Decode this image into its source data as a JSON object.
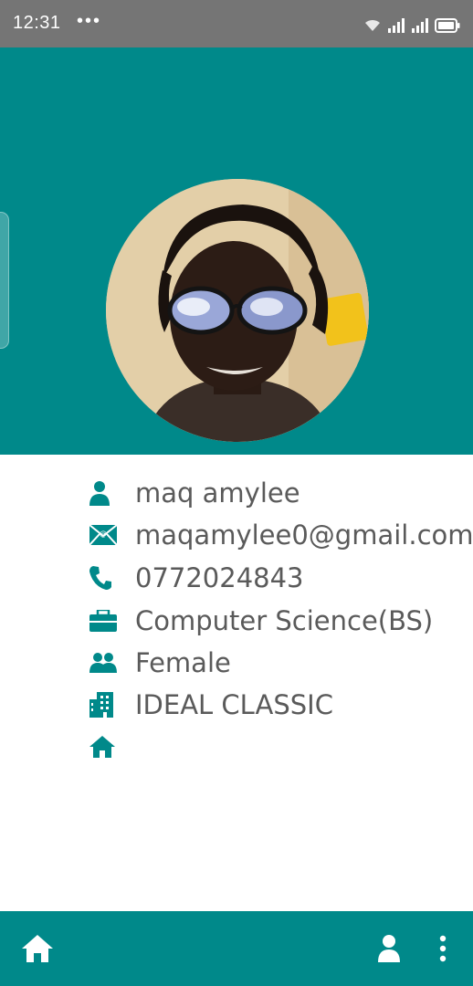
{
  "status_bar": {
    "time": "12:31",
    "dots": "•••"
  },
  "profile": {
    "name": "maq amylee",
    "email": "maqamylee0@gmail.com",
    "phone": "0772024843",
    "course": "Computer Science(BS)",
    "gender": "Female",
    "school": "IDEAL CLASSIC",
    "address": ""
  },
  "icons": {
    "name": "person-icon",
    "email": "email-icon",
    "phone": "phone-icon",
    "course": "briefcase-icon",
    "gender": "people-icon",
    "school": "building-icon",
    "address": "home-icon"
  },
  "colors": {
    "primary": "#00898a",
    "status_bar": "#757575",
    "text": "#5a5a5a"
  },
  "bottom_nav": {
    "left": "home-icon",
    "right": [
      "person-icon",
      "more-vert-icon"
    ]
  }
}
